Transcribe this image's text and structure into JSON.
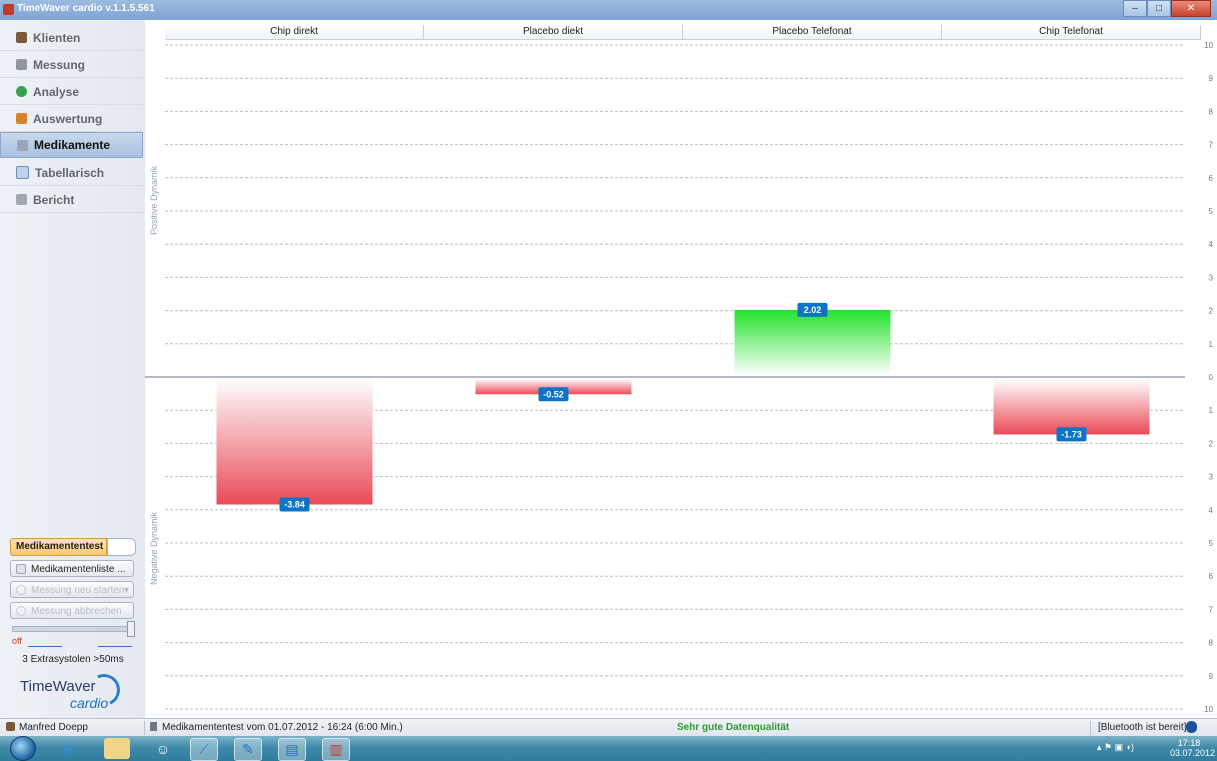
{
  "window": {
    "title": "TimeWaver cardio v.1.1.5.561",
    "buttons": [
      "–",
      "□",
      "✕"
    ]
  },
  "sidebar": {
    "items": [
      {
        "label": "Klienten",
        "icon": "person-icon",
        "active": false
      },
      {
        "label": "Messung",
        "icon": "device-icon",
        "active": false
      },
      {
        "label": "Analyse",
        "icon": "analyse-icon",
        "active": false
      },
      {
        "label": "Auswertung",
        "icon": "monitor-icon",
        "active": false
      },
      {
        "label": "Medikamente",
        "icon": "medicine-icon",
        "active": true
      },
      {
        "label": "Tabellarisch",
        "icon": "table-icon",
        "active": false
      },
      {
        "label": "Bericht",
        "icon": "print-icon",
        "active": false
      }
    ],
    "toggle_label": "Medikamententest",
    "list_button": "Medikamentenliste ...",
    "restart_button": "Messung neu starten",
    "abort_button": "Messung abbrechen",
    "slider_off_label": "off",
    "slider_value": 1.0,
    "extrasystoles_text": "3 Extrasystolen >50ms",
    "logo_text": "TimeWaver",
    "logo_sub": "cardio"
  },
  "chart_data": {
    "type": "bar",
    "categories": [
      "Chip direkt",
      "Placebo diekt",
      "Placebo Telefonat",
      "Chip Telefonat"
    ],
    "values": [
      -3.84,
      -0.52,
      2.02,
      -1.73
    ],
    "value_labels": [
      "-3.84",
      "-0.52",
      "2.02",
      "-1.73"
    ],
    "ylim": [
      -10,
      10
    ],
    "yticks": [
      10,
      9,
      8,
      7,
      6,
      5,
      4,
      3,
      2,
      1,
      0,
      1,
      2,
      3,
      4,
      5,
      6,
      7,
      8,
      9,
      10
    ],
    "positive_label": "Positive Dynamik",
    "negative_label": "Negative Dynamik",
    "grid": true,
    "colors": {
      "positive": "#22e22a",
      "negative": "#e94a58",
      "label_bg": "#0b74c4"
    }
  },
  "status": {
    "user": "Manfred Doepp",
    "session": "Medikamententest vom 01.07.2012 - 16:24  (6:00 Min.)",
    "quality": "Sehr gute Datenqualität",
    "bluetooth": "[Bluetooth ist bereit]"
  },
  "taskbar": {
    "time": "17:18",
    "date": "03.07.2012"
  }
}
